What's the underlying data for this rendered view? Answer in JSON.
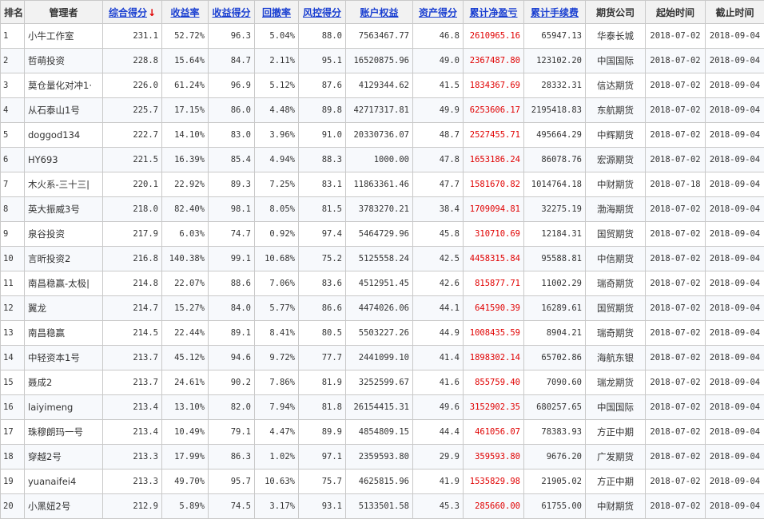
{
  "headers": [
    "排名",
    "管理者",
    "综合得分",
    "收益率",
    "收益得分",
    "回撤率",
    "风控得分",
    "账户权益",
    "资产得分",
    "累计净盈亏",
    "累计手续费",
    "期货公司",
    "起始时间",
    "截止时间"
  ],
  "sort_arrow": "↓",
  "rows": [
    [
      "1",
      "小牛工作室",
      "231.1",
      "52.72%",
      "96.3",
      "5.04%",
      "88.0",
      "7563467.77",
      "46.8",
      "2610965.16",
      "65947.13",
      "华泰长城",
      "2018-07-02",
      "2018-09-04"
    ],
    [
      "2",
      "哲萌投资",
      "228.8",
      "15.64%",
      "84.7",
      "2.11%",
      "95.1",
      "16520875.96",
      "49.0",
      "2367487.80",
      "123102.20",
      "中国国际",
      "2018-07-02",
      "2018-09-04"
    ],
    [
      "3",
      "莫仓量化对冲1·",
      "226.0",
      "61.24%",
      "96.9",
      "5.12%",
      "87.6",
      "4129344.62",
      "41.5",
      "1834367.69",
      "28332.31",
      "信达期货",
      "2018-07-02",
      "2018-09-04"
    ],
    [
      "4",
      "从石泰山1号",
      "225.7",
      "17.15%",
      "86.0",
      "4.48%",
      "89.8",
      "42717317.81",
      "49.9",
      "6253606.17",
      "2195418.83",
      "东航期货",
      "2018-07-02",
      "2018-09-04"
    ],
    [
      "5",
      "doggod134",
      "222.7",
      "14.10%",
      "83.0",
      "3.96%",
      "91.0",
      "20330736.07",
      "48.7",
      "2527455.71",
      "495664.29",
      "中辉期货",
      "2018-07-02",
      "2018-09-04"
    ],
    [
      "6",
      "HY693",
      "221.5",
      "16.39%",
      "85.4",
      "4.94%",
      "88.3",
      "1000.00",
      "47.8",
      "1653186.24",
      "86078.76",
      "宏源期货",
      "2018-07-02",
      "2018-09-04"
    ],
    [
      "7",
      "木火系-三十三|",
      "220.1",
      "22.92%",
      "89.3",
      "7.25%",
      "83.1",
      "11863361.46",
      "47.7",
      "1581670.82",
      "1014764.18",
      "中财期货",
      "2018-07-18",
      "2018-09-04"
    ],
    [
      "8",
      "英大振威3号",
      "218.0",
      "82.40%",
      "98.1",
      "8.05%",
      "81.5",
      "3783270.21",
      "38.4",
      "1709094.81",
      "32275.19",
      "渤海期货",
      "2018-07-02",
      "2018-09-04"
    ],
    [
      "9",
      "泉谷投资",
      "217.9",
      "6.03%",
      "74.7",
      "0.92%",
      "97.4",
      "5464729.96",
      "45.8",
      "310710.69",
      "12184.31",
      "国贸期货",
      "2018-07-02",
      "2018-09-04"
    ],
    [
      "10",
      "言昕投资2",
      "216.8",
      "140.38%",
      "99.1",
      "10.68%",
      "75.2",
      "5125558.24",
      "42.5",
      "4458315.84",
      "95588.81",
      "中信期货",
      "2018-07-02",
      "2018-09-04"
    ],
    [
      "11",
      "南昌稳赢-太极|",
      "214.8",
      "22.07%",
      "88.6",
      "7.06%",
      "83.6",
      "4512951.45",
      "42.6",
      "815877.71",
      "11002.29",
      "瑞奇期货",
      "2018-07-02",
      "2018-09-04"
    ],
    [
      "12",
      "翼龙",
      "214.7",
      "15.27%",
      "84.0",
      "5.77%",
      "86.6",
      "4474026.06",
      "44.1",
      "641590.39",
      "16289.61",
      "国贸期货",
      "2018-07-02",
      "2018-09-04"
    ],
    [
      "13",
      "南昌稳赢",
      "214.5",
      "22.44%",
      "89.1",
      "8.41%",
      "80.5",
      "5503227.26",
      "44.9",
      "1008435.59",
      "8904.21",
      "瑞奇期货",
      "2018-07-02",
      "2018-09-04"
    ],
    [
      "14",
      "中轻资本1号",
      "213.7",
      "45.12%",
      "94.6",
      "9.72%",
      "77.7",
      "2441099.10",
      "41.4",
      "1898302.14",
      "65702.86",
      "海航东银",
      "2018-07-02",
      "2018-09-04"
    ],
    [
      "15",
      "聂成2",
      "213.7",
      "24.61%",
      "90.2",
      "7.86%",
      "81.9",
      "3252599.67",
      "41.6",
      "855759.40",
      "7090.60",
      "瑞龙期货",
      "2018-07-02",
      "2018-09-04"
    ],
    [
      "16",
      "laiyimeng",
      "213.4",
      "13.10%",
      "82.0",
      "7.94%",
      "81.8",
      "26154415.31",
      "49.6",
      "3152902.35",
      "680257.65",
      "中国国际",
      "2018-07-02",
      "2018-09-04"
    ],
    [
      "17",
      "珠穆朗玛一号",
      "213.4",
      "10.49%",
      "79.1",
      "4.47%",
      "89.9",
      "4854809.15",
      "44.4",
      "461056.07",
      "78383.93",
      "方正中期",
      "2018-07-02",
      "2018-09-04"
    ],
    [
      "18",
      "穿越2号",
      "213.3",
      "17.99%",
      "86.3",
      "1.02%",
      "97.1",
      "2359593.80",
      "29.9",
      "359593.80",
      "9676.20",
      "广发期货",
      "2018-07-02",
      "2018-09-04"
    ],
    [
      "19",
      "yuanaifei4",
      "213.3",
      "49.70%",
      "95.7",
      "10.63%",
      "75.7",
      "4625815.96",
      "41.9",
      "1535829.98",
      "21905.02",
      "方正中期",
      "2018-07-02",
      "2018-09-04"
    ],
    [
      "20",
      "小黑妞2号",
      "212.9",
      "5.89%",
      "74.5",
      "3.17%",
      "93.1",
      "5133501.58",
      "45.3",
      "285660.00",
      "61755.00",
      "中财期货",
      "2018-07-02",
      "2018-09-04"
    ]
  ],
  "colors": {
    "link": "#1a3fd1",
    "profit": "#e00000",
    "header_bg": "#f2f2f2",
    "border": "#c9c9c9"
  }
}
